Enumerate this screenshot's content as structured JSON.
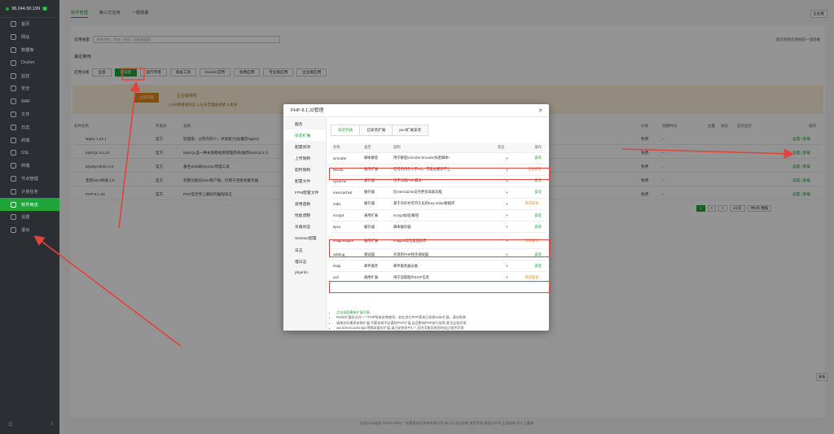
{
  "sidebar": {
    "ip": "38.244.50.199",
    "badge": "4",
    "items": [
      {
        "label": "首页",
        "icon": "home-icon"
      },
      {
        "label": "网站",
        "icon": "globe-icon"
      },
      {
        "label": "数据库",
        "icon": "database-icon"
      },
      {
        "label": "Docker",
        "icon": "docker-icon"
      },
      {
        "label": "监控",
        "icon": "monitor-icon"
      },
      {
        "label": "安全",
        "icon": "shield-icon"
      },
      {
        "label": "WAF",
        "icon": "firewall-icon"
      },
      {
        "label": "文件",
        "icon": "folder-icon"
      },
      {
        "label": "日志",
        "icon": "log-icon"
      },
      {
        "label": "终端",
        "icon": "terminal-icon"
      },
      {
        "label": "SSL",
        "icon": "lock-icon"
      },
      {
        "label": "终端",
        "icon": "terminal-icon"
      },
      {
        "label": "节点管理",
        "icon": "node-icon"
      },
      {
        "label": "计划任务",
        "icon": "clock-icon"
      },
      {
        "label": "软件商店",
        "icon": "apps-icon"
      },
      {
        "label": "设置",
        "icon": "gear-icon"
      },
      {
        "label": "退出",
        "icon": "logout-icon"
      }
    ],
    "active_index": 14,
    "foot_left": "☰",
    "foot_right": "≡"
  },
  "main": {
    "tabs": [
      "软件管理",
      "第三方应用",
      "一键部署"
    ],
    "top_right_button": "企业版",
    "search_label": "应用搜索",
    "search_placeholder": "支持名称、字母、拼音，回车键搜索",
    "search_right": "最近使用/应用推荐/一键部署",
    "section_title": "最近使用",
    "category_label": "应用分类",
    "categories": [
      "全部",
      "已安装",
      "运行环境",
      "系统工具",
      "Docker应用",
      "免费应用",
      "专业版应用",
      "企业版应用"
    ],
    "selected_category_index": 1,
    "banner_button": "立即升级",
    "banner_title": "企业版特权",
    "banner_text": "1.5分钟极速响应    2.15天无理由退款    3.更多",
    "table_headers": [
      "软件名称",
      "开发商",
      "说明",
      "价格",
      "到期时间",
      "位置",
      "状态",
      "首页显示",
      "操作"
    ],
    "rows": [
      {
        "name": "Nginx 1.22.1",
        "dev": "官方",
        "desc": "轻量级，占有内存少，并发能力强(推荐Nginx)",
        "price": "免费",
        "expire": "--",
        "ops": "设置 | 卸载"
      },
      {
        "name": "MySQL 8.0.24",
        "dev": "官方",
        "desc": "MySQL是一种关系数据库管理系统(推荐MySQL5.7)",
        "price": "免费",
        "expire": "--",
        "ops": "设置 | 卸载"
      },
      {
        "name": "phpMyAdmin 5.0",
        "dev": "官方",
        "desc": "著名Web端MySQL管理工具",
        "price": "免费",
        "expire": "--",
        "ops": "设置 | 卸载"
      },
      {
        "name": "宝塔SSH终端 1.0",
        "dev": "官方",
        "desc": "完整功能的SSH客户端，仅用于连接本服务器",
        "price": "免费",
        "expire": "--",
        "ops": "设置 | 卸载"
      },
      {
        "name": "PHP-8.1.32",
        "dev": "官方",
        "desc": "PHP是世界上最好的编程语言",
        "price": "免费",
        "expire": "--",
        "ops": "设置 | 卸载"
      }
    ],
    "pager": [
      "1",
      "<",
      ">",
      "1/1页"
    ],
    "pager_total": "共5条 数据",
    "footer": "宝塔Linux面板 ©2014-2025 广东堡塔安全技术有限公司 (bt.cn)    论坛求助    使用手册    微信公众号    正版查询    官人工客服",
    "float_help": "客服"
  },
  "dialog": {
    "title": "PHP-8.1.32管理",
    "close": "×",
    "nav": [
      "服务",
      "安装扩展",
      "配置修改",
      "上传限制",
      "超时限制",
      "配置文件",
      "FPM配置文件",
      "禁用函数",
      "性能调整",
      "负载状态",
      "Session配置",
      "日志",
      "慢日志",
      "phpinfo"
    ],
    "active_nav_index": 1,
    "subtabs": [
      "安装列表",
      "已安装扩展",
      "pecl扩展安装"
    ],
    "table_headers": [
      "名称",
      "类型",
      "说明",
      "状态",
      "操作"
    ],
    "extensions": [
      {
        "name": "ionCube",
        "type": "脚本解密",
        "desc": "用于解密ionCube Encoder加密脚本!",
        "status": "×",
        "op": "安装"
      },
      {
        "name": "fileinfo",
        "type": "通用扩展",
        "desc": "若可用内存小于1G，可能会安装不上",
        "status": "×",
        "op": "正在安装"
      },
      {
        "name": "opcache",
        "type": "缓存器",
        "desc": "用于加速PHP脚本!",
        "status": "×",
        "op": "安装"
      },
      {
        "name": "memcached",
        "type": "缓存器",
        "desc": "比memcache支持更多高级功能",
        "status": "×",
        "op": "安装"
      },
      {
        "name": "redis",
        "type": "缓存器",
        "desc": "基于内存亦可持久化的Key-Value数据库",
        "status": "×",
        "op": "等待安装..."
      },
      {
        "name": "mcrypt",
        "type": "通用扩展",
        "desc": "mcrypt加密/解密",
        "status": "×",
        "op": "安装"
      },
      {
        "name": "apcu",
        "type": "缓存器",
        "desc": "脚本缓存器",
        "status": "×",
        "op": "安装"
      },
      {
        "name": "imagemagick",
        "type": "通用扩展",
        "desc": "Imagick高性能图形库",
        "status": "×",
        "op": "等待安装..."
      },
      {
        "name": "xdebug",
        "type": "调试器",
        "desc": "开源的PHP程序调试器",
        "status": "×",
        "op": "安装"
      },
      {
        "name": "imap",
        "type": "邮件服务",
        "desc": "邮件服务器必备",
        "status": "×",
        "op": "安装"
      },
      {
        "name": "exif",
        "type": "通用扩展",
        "desc": "用于读取图片EXIF信息",
        "status": "×",
        "op": "等待安装..."
      }
    ],
    "notes_link": "点击获取最新扩展列表",
    "notes": [
      "Redis扩展仅允许一个PHP版本安装使用，若在其它PHP版本已安装redis扩展，请勿再装",
      "请按实际需求安装扩展,不要安装不必要的PHP扩展,这会影响PHP执行效率,甚至出现异常",
      "opcache/xcache/apc等脚本缓存扩展,请只安装其中1个,否则可能导致您的站点程序异常"
    ]
  },
  "colors": {
    "accent": "#20a53a",
    "sidebar_bg": "#2b2f33",
    "warning": "#e08a1e",
    "annotation": "#e0443d"
  }
}
